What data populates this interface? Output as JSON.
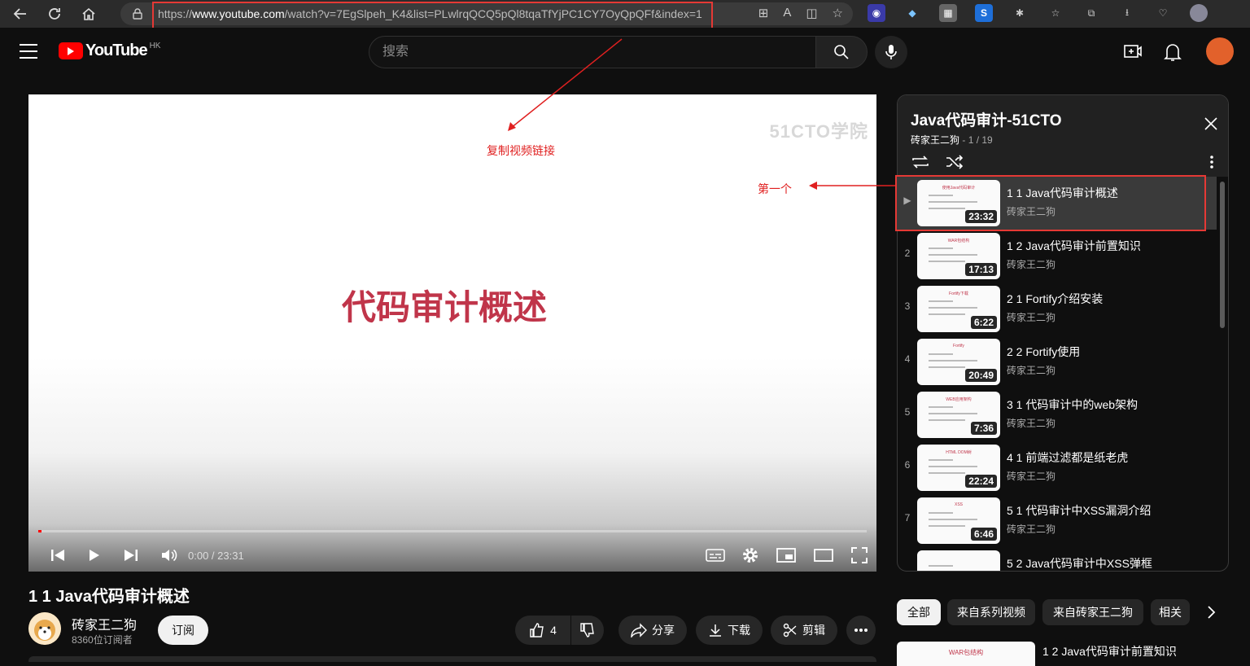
{
  "browser": {
    "url_prefix": "https://",
    "url_host": "www.youtube.com",
    "url_rest": "/watch?v=7EgSlpeh_K4&list=PLwlrqQCQ5pQl8tqaTfYjPC1CY7OyQpQFf&index=1"
  },
  "header": {
    "logo_text": "YouTube",
    "region": "HK",
    "search_placeholder": "搜索"
  },
  "player": {
    "watermark": "51CTO学院",
    "slide_title": "代码审计概述",
    "time": "0:00 / 23:31",
    "progress_fraction": 0.004
  },
  "annotations": {
    "copy_link": "复制视频链接",
    "first": "第一个"
  },
  "video": {
    "title": "1 1 Java代码审计概述",
    "channel": "砖家王二狗",
    "subscribers": "8360位订阅者",
    "subscribe": "订阅",
    "likes": "4",
    "share": "分享",
    "download": "下载",
    "clip": "剪辑"
  },
  "playlist": {
    "title": "Java代码审计-51CTO",
    "owner": "砖家王二狗",
    "position": "1 / 19",
    "items": [
      {
        "index": "▶",
        "title": "1 1 Java代码审计概述",
        "author": "砖家王二狗",
        "duration": "23:32",
        "thumb_head": "使用Java代码审计"
      },
      {
        "index": "2",
        "title": "1 2 Java代码审计前置知识",
        "author": "砖家王二狗",
        "duration": "17:13",
        "thumb_head": "WAR包结构"
      },
      {
        "index": "3",
        "title": "2 1 Fortify介绍安装",
        "author": "砖家王二狗",
        "duration": "6:22",
        "thumb_head": "Fortify下载"
      },
      {
        "index": "4",
        "title": "2 2 Fortify使用",
        "author": "砖家王二狗",
        "duration": "20:49",
        "thumb_head": "Fortify"
      },
      {
        "index": "5",
        "title": "3 1 代码审计中的web架构",
        "author": "砖家王二狗",
        "duration": "7:36",
        "thumb_head": "WEB应用架构"
      },
      {
        "index": "6",
        "title": "4 1 前端过滤都是纸老虎",
        "author": "砖家王二狗",
        "duration": "22:24",
        "thumb_head": "HTML DOM树"
      },
      {
        "index": "7",
        "title": "5 1 代码审计中XSS漏洞介绍",
        "author": "砖家王二狗",
        "duration": "6:46",
        "thumb_head": "XSS"
      },
      {
        "index": "",
        "title": "5 2 Java代码审计中XSS弹框",
        "author": "",
        "duration": "",
        "thumb_head": ""
      }
    ]
  },
  "chips": [
    {
      "label": "全部",
      "selected": true
    },
    {
      "label": "来自系列视频",
      "selected": false
    },
    {
      "label": "来自砖家王二狗",
      "selected": false
    },
    {
      "label": "相关",
      "selected": false
    }
  ],
  "recommendation": {
    "thumb_head": "WAR包结构",
    "title": "1 2 Java代码审计前置知识"
  }
}
